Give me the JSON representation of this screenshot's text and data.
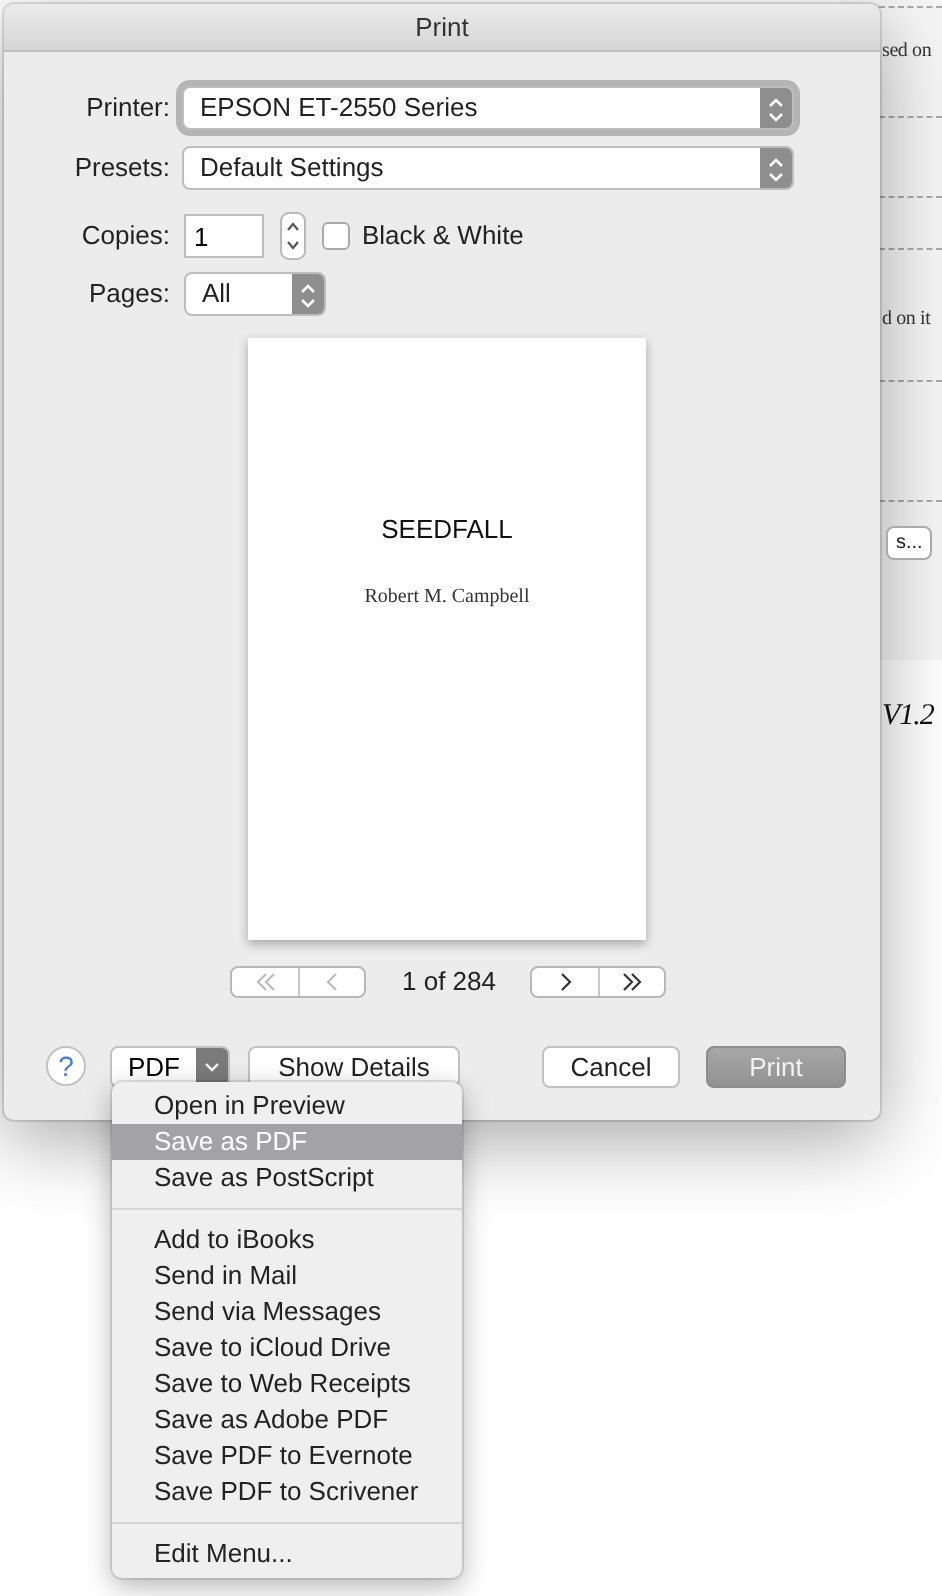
{
  "background_document": {
    "fragments": [
      {
        "kind": "text",
        "text": "sed on"
      },
      {
        "kind": "text",
        "text": "d on it"
      },
      {
        "kind": "button",
        "text": "s..."
      },
      {
        "kind": "italic",
        "text": "V1.2"
      }
    ]
  },
  "window": {
    "title": "Print"
  },
  "printer": {
    "label": "Printer:",
    "value": "EPSON ET-2550 Series"
  },
  "presets": {
    "label": "Presets:",
    "value": "Default Settings"
  },
  "copies": {
    "label": "Copies:",
    "value": "1"
  },
  "black_white": {
    "label": "Black & White",
    "checked": false
  },
  "pages": {
    "label": "Pages:",
    "value": "All"
  },
  "preview": {
    "title": "SEEDFALL",
    "author": "Robert M. Campbell"
  },
  "page_nav": {
    "buttons": [
      {
        "kind": "first",
        "disabled": true
      },
      {
        "kind": "previous",
        "disabled": true
      },
      {
        "kind": "next",
        "disabled": false
      },
      {
        "kind": "last",
        "disabled": false
      }
    ],
    "counter": "1 of 284"
  },
  "help_button": "?",
  "pdf_button": {
    "label": "PDF"
  },
  "buttons": [
    {
      "label": "Show Details",
      "kind": "normal"
    },
    {
      "label": "Cancel",
      "kind": "normal"
    },
    {
      "label": "Print",
      "kind": "default"
    }
  ],
  "pdf_menu": {
    "sections": [
      {
        "items": [
          {
            "label": "Open in Preview",
            "selected": false
          },
          {
            "label": "Save as PDF",
            "selected": true
          },
          {
            "label": "Save as PostScript",
            "selected": false
          }
        ]
      },
      {
        "items": [
          {
            "label": "Add to iBooks",
            "selected": false
          },
          {
            "label": "Send in Mail",
            "selected": false
          },
          {
            "label": "Send via Messages",
            "selected": false
          },
          {
            "label": "Save to iCloud Drive",
            "selected": false
          },
          {
            "label": "Save to Web Receipts",
            "selected": false
          },
          {
            "label": "Save as Adobe PDF",
            "selected": false
          },
          {
            "label": "Save PDF to Evernote",
            "selected": false
          },
          {
            "label": "Save PDF to Scrivener",
            "selected": false
          }
        ]
      },
      {
        "items": [
          {
            "label": "Edit Menu...",
            "selected": false
          }
        ]
      }
    ]
  }
}
